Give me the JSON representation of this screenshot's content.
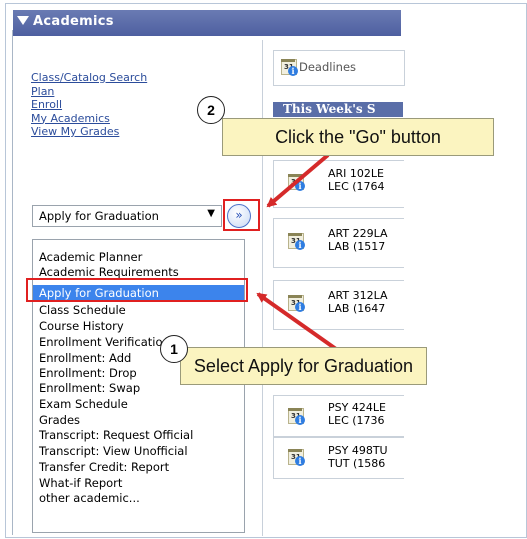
{
  "header": {
    "title": "Academics",
    "collapse_icon": "triangle-down-icon"
  },
  "nav_links": [
    {
      "label": "Class/Catalog Search"
    },
    {
      "label": "Plan"
    },
    {
      "label": "Enroll"
    },
    {
      "label": "My Academics"
    },
    {
      "label": "View My Grades"
    }
  ],
  "select": {
    "value": "Apply for Graduation",
    "arrow": "▼"
  },
  "go_button": {
    "label": "»",
    "icon": "double-chevron-right-icon"
  },
  "options": [
    {
      "label": "Academic Planner"
    },
    {
      "label": "Academic Requirements"
    },
    {
      "label": "Apply for Graduation",
      "selected": true
    },
    {
      "label": "Class Schedule"
    },
    {
      "label": "Course History"
    },
    {
      "label": "Enrollment Verification"
    },
    {
      "label": "Enrollment: Add"
    },
    {
      "label": "Enrollment: Drop"
    },
    {
      "label": "Enrollment: Swap"
    },
    {
      "label": "Exam Schedule"
    },
    {
      "label": "Grades"
    },
    {
      "label": "Transcript: Request Official"
    },
    {
      "label": "Transcript: View Unofficial"
    },
    {
      "label": "Transfer Credit: Report"
    },
    {
      "label": "What-if Report"
    },
    {
      "label": "other academic..."
    }
  ],
  "deadlines": {
    "label": "Deadlines"
  },
  "schedule": {
    "header": "This Week's S",
    "rows": [
      {
        "line1": "ARI 102LE",
        "line2": "LEC (1764"
      },
      {
        "line1": "ART 229LA",
        "line2": "LAB (1517"
      },
      {
        "line1": "ART 312LA",
        "line2": "LAB (1647"
      },
      {
        "line1": "PSY 424LE",
        "line2": "LEC (1736"
      },
      {
        "line1": "PSY 498TU",
        "line2": "TUT (1586"
      }
    ]
  },
  "callouts": {
    "step1": {
      "number": "1",
      "text": "Select Apply for Graduation"
    },
    "step2": {
      "number": "2",
      "text": "Click the \"Go\" button"
    }
  },
  "colors": {
    "header": "#5a6aa8",
    "link": "#2b4c9b",
    "selection": "#3c84ec",
    "highlight": "#e02020",
    "callout_bg": "#fbf4c0"
  }
}
